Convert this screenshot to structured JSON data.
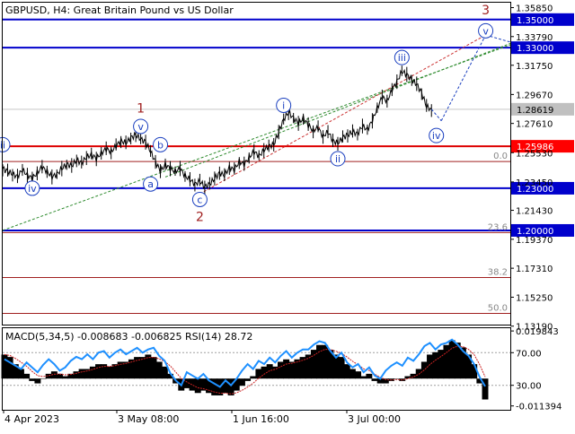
{
  "title": "GBPUSD, H4:  Great Britain Pound vs US Dollar",
  "colors": {
    "background": "#ffffff",
    "frame": "#000000",
    "price_line": "#000000",
    "level_blue": "#0000cc",
    "level_red": "#dd0000",
    "label_red_bg": "#ff0000",
    "label_blue_bg": "#0000cc",
    "label_current_bg": "#c0c0c0",
    "wave_minor": "#1a3fbf",
    "wave_major": "#a02020",
    "fib_red": "#a02020",
    "macd_hist": "#000000",
    "rsi": "#1e90ff"
  },
  "chart_data": [
    {
      "type": "line",
      "name": "price",
      "title": "GBPUSD, H4:  Great Britain Pound vs US Dollar",
      "ylim": [
        1.133,
        1.362
      ],
      "xlabel": "",
      "ylabel": "",
      "x_ticks": [
        "4 Apr 2023",
        "3 May 08:00",
        "1 Jun 16:00",
        "3 Jul 00:00"
      ],
      "y_ticks": [
        "1.35850",
        "1.33790",
        "1.31750",
        "1.29670",
        "1.27610",
        "1.25530",
        "1.23450",
        "1.21430",
        "1.19370",
        "1.17310",
        "1.15250",
        "1.13190"
      ],
      "close_series": [
        1.244,
        1.242,
        1.24,
        1.2385,
        1.243,
        1.2395,
        1.237,
        1.241,
        1.245,
        1.242,
        1.238,
        1.24,
        1.244,
        1.247,
        1.246,
        1.25,
        1.248,
        1.252,
        1.254,
        1.251,
        1.255,
        1.258,
        1.256,
        1.26,
        1.264,
        1.262,
        1.266,
        1.268,
        1.265,
        1.263,
        1.256,
        1.249,
        1.242,
        1.247,
        1.244,
        1.242,
        1.244,
        1.239,
        1.236,
        1.233,
        1.235,
        1.231,
        1.233,
        1.237,
        1.241,
        1.239,
        1.245,
        1.243,
        1.249,
        1.247,
        1.252,
        1.256,
        1.253,
        1.257,
        1.26,
        1.261,
        1.27,
        1.279,
        1.284,
        1.28,
        1.276,
        1.28,
        1.275,
        1.271,
        1.273,
        1.267,
        1.27,
        1.264,
        1.262,
        1.266,
        1.268,
        1.27,
        1.269,
        1.274,
        1.272,
        1.278,
        1.287,
        1.295,
        1.292,
        1.3,
        1.306,
        1.313,
        1.311,
        1.307,
        1.304,
        1.298,
        1.288,
        1.2862
      ],
      "levels": [
        {
          "value": 1.35,
          "label": "1.35000",
          "style": "blue"
        },
        {
          "value": 1.33,
          "label": "1.33000",
          "style": "blue"
        },
        {
          "value": 1.25986,
          "label": "1.25986",
          "style": "red"
        },
        {
          "value": 1.23,
          "label": "1.23000",
          "style": "blue"
        },
        {
          "value": 1.2,
          "label": "1.20000",
          "style": "blue"
        },
        {
          "value": 1.28619,
          "label": "1.28619",
          "style": "current"
        }
      ],
      "fibonacci": [
        {
          "value": 1.249,
          "label": "0.0"
        },
        {
          "value": 1.1985,
          "label": "23.6"
        },
        {
          "value": 1.1665,
          "label": "38.2"
        },
        {
          "value": 1.141,
          "label": "50.0"
        }
      ],
      "wave_labels": [
        {
          "text": "ii",
          "circled": true,
          "major": false,
          "index": 0,
          "value": 1.261
        },
        {
          "text": "iv",
          "circled": true,
          "major": false,
          "index": 6,
          "value": 1.23
        },
        {
          "text": "1",
          "circled": false,
          "major": true,
          "index": 28,
          "value": 1.287
        },
        {
          "text": "v",
          "circled": true,
          "major": false,
          "index": 28,
          "value": 1.274
        },
        {
          "text": "b",
          "circled": true,
          "major": false,
          "index": 32,
          "value": 1.261
        },
        {
          "text": "a",
          "circled": true,
          "major": false,
          "index": 30,
          "value": 1.233
        },
        {
          "text": "c",
          "circled": true,
          "major": false,
          "index": 40,
          "value": 1.222
        },
        {
          "text": "2",
          "circled": false,
          "major": true,
          "index": 40,
          "value": 1.21
        },
        {
          "text": "i",
          "circled": true,
          "major": false,
          "index": 57,
          "value": 1.289
        },
        {
          "text": "ii",
          "circled": true,
          "major": false,
          "index": 68,
          "value": 1.251
        },
        {
          "text": "iii",
          "circled": true,
          "major": false,
          "index": 81,
          "value": 1.323
        },
        {
          "text": "iv",
          "circled": true,
          "major": false,
          "index": 88,
          "value": 1.2675
        },
        {
          "text": "v",
          "circled": true,
          "major": false,
          "index": 98,
          "value": 1.342
        },
        {
          "text": "3",
          "circled": false,
          "major": true,
          "index": 98,
          "value": 1.357
        }
      ],
      "projections": [
        {
          "from": [
            87,
            1.2862
          ],
          "to": [
            89,
            1.278
          ]
        },
        {
          "from": [
            89,
            1.278
          ],
          "to": [
            98,
            1.339
          ]
        },
        {
          "from": [
            98,
            1.339
          ],
          "to": [
            103,
            1.334
          ]
        }
      ],
      "trend_lines": [
        {
          "from": [
            0,
            1.2
          ],
          "to": [
            103,
            1.332
          ],
          "color": "green"
        },
        {
          "from": [
            33,
            1.238
          ],
          "to": [
            103,
            1.333
          ],
          "color": "green"
        },
        {
          "from": [
            40,
            1.226
          ],
          "to": [
            98,
            1.339
          ],
          "color": "red"
        }
      ]
    },
    {
      "type": "bar",
      "name": "oscillator",
      "title": "MACD(5,34,5) -0.008683 -0.006825 RSI(14) 28.72",
      "ylim": [
        -0.013,
        0.021
      ],
      "y_ticks": [
        "0.019843",
        "70.00",
        "30.00",
        "-0.011394"
      ],
      "macd_values": [
        0.01,
        0.009,
        0.006,
        0.004,
        0.002,
        -0.001,
        -0.002,
        0.0,
        0.002,
        0.003,
        0.002,
        0.001,
        0.002,
        0.003,
        0.004,
        0.004,
        0.005,
        0.006,
        0.006,
        0.005,
        0.006,
        0.007,
        0.007,
        0.008,
        0.009,
        0.009,
        0.01,
        0.009,
        0.007,
        0.005,
        0.002,
        -0.002,
        -0.005,
        -0.004,
        -0.005,
        -0.006,
        -0.005,
        -0.006,
        -0.007,
        -0.007,
        -0.006,
        -0.007,
        -0.005,
        -0.003,
        -0.001,
        0.001,
        0.004,
        0.005,
        0.006,
        0.005,
        0.007,
        0.008,
        0.007,
        0.008,
        0.009,
        0.01,
        0.012,
        0.014,
        0.014,
        0.012,
        0.01,
        0.009,
        0.006,
        0.004,
        0.003,
        0.001,
        0.002,
        -0.001,
        -0.002,
        -0.002,
        -0.001,
        0.0,
        -0.001,
        0.001,
        0.002,
        0.004,
        0.007,
        0.01,
        0.011,
        0.012,
        0.014,
        0.016,
        0.015,
        0.013,
        0.01,
        0.006,
        -0.002,
        -0.0087
      ],
      "rsi_values": [
        62,
        58,
        54,
        50,
        58,
        52,
        46,
        55,
        62,
        56,
        48,
        52,
        60,
        65,
        62,
        68,
        62,
        70,
        72,
        64,
        70,
        74,
        68,
        72,
        76,
        70,
        74,
        76,
        66,
        60,
        45,
        36,
        30,
        46,
        42,
        38,
        44,
        36,
        32,
        28,
        36,
        30,
        38,
        48,
        56,
        50,
        60,
        56,
        64,
        58,
        66,
        72,
        64,
        70,
        74,
        74,
        80,
        84,
        82,
        72,
        64,
        70,
        58,
        52,
        56,
        46,
        52,
        42,
        38,
        48,
        54,
        58,
        54,
        64,
        60,
        68,
        78,
        82,
        74,
        80,
        82,
        86,
        80,
        72,
        66,
        56,
        40,
        28.72
      ]
    }
  ]
}
